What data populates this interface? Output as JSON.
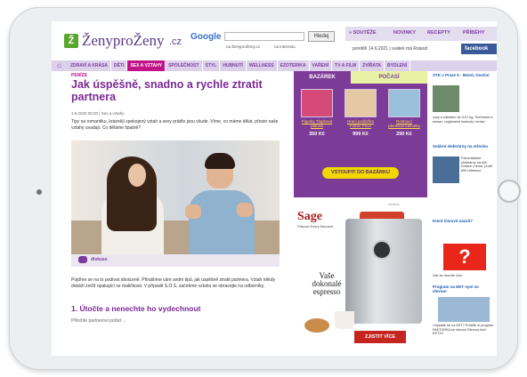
{
  "site": {
    "logo_mark": "Ž",
    "logo_name": "ŽenyproŽeny",
    "logo_tld": ".cz",
    "google": "Google",
    "search_button": "Hledej",
    "radio_site": "na ŽenyproŽeny.cz",
    "radio_web": "na internetu",
    "top_links": [
      "» SOUTĚŽE",
      "NOVINKY",
      "RECEPTY",
      "PŘÍBĚHY"
    ],
    "date_line": "pondělí 14.6.2021  |  svátek má Roland",
    "facebook": "facebook"
  },
  "nav": {
    "items": [
      "ZDRAVÍ A KRÁSA",
      "DĚTI",
      "SEX A VZTAHY",
      "SPOLEČNOST",
      "STYL",
      "HUBNUTÍ",
      "WELLNESS",
      "EZOTERIKA",
      "VAŘENÍ",
      "TV A FILM",
      "ZVÍŘATA",
      "BYDLENÍ"
    ],
    "active": "SEX A VZTAHY"
  },
  "article": {
    "rubric": "PENÍZE",
    "title": "Jak úspěšně, snadno a rychle ztratit partnera",
    "meta": "1.9.2020 00:00  |  Sex a vztahy",
    "lead": "Tipy na romantiku, krásnějí spokojený vztah a sexy prádlo jsou všude. Víme, co máme dělat, přesto naše vztahy uvadají. Co děláme špatně?",
    "discussion": "diskuse",
    "paragraph": "Pojďme se na to podívat obráceně. Přinášíme vám sedm tipů, jak úspěšně ztratit partnera. Vztah někdy dokáží zničit opakující se maličkosti. V případě S.O.S. začněme vztahu se obracejte na odborníky.",
    "heading": "1. Útočte a nenechte ho vydechnout",
    "paragraph2": "Přiložíte partnerovi pořád ..."
  },
  "bazar": {
    "tab_bazar": "BAZÁREK",
    "tab_pocasi": "POČASÍ",
    "products": [
      {
        "name": "Figurky Tlapková patrola",
        "price": "350 Kč"
      },
      {
        "name": "Hrací podložka Fisher Price",
        "price": "999 Kč"
      },
      {
        "name": "Rostoucí plenkové kalhotky",
        "price": "290 Kč"
      }
    ],
    "button": "VSTOUPIT DO BAZÁRKU",
    "ad_label": "reklama"
  },
  "ad": {
    "brand": "Sage",
    "tagline": "Flavour Every Moment",
    "slogan": "Vaše dokonalé espresso",
    "cta": "ZJISTIT VÍCE"
  },
  "right": {
    "items": [
      {
        "title": "STK v Praze 5 - Motol, Ovoční",
        "text": "vozy a nákladní do 3,5 t.ng. Technické a emisní, registrační kontroly i emise."
      },
      {
        "title": "Solární elektrárny na střechu",
        "text": "Fotovoltaické elektrárny na klíč. Dotace z lemu, profit 600 referencí."
      },
      {
        "title": "Které čtivové názvů?",
        "text": "Zde se dozvíte více.",
        "mark": "?"
      },
      {
        "title": "Program na EET nyní se slevou!",
        "text": "Chystáte se na EET? Pořiďte si program FAKTURKA se slevou! Slevový kód: EET19"
      }
    ]
  }
}
